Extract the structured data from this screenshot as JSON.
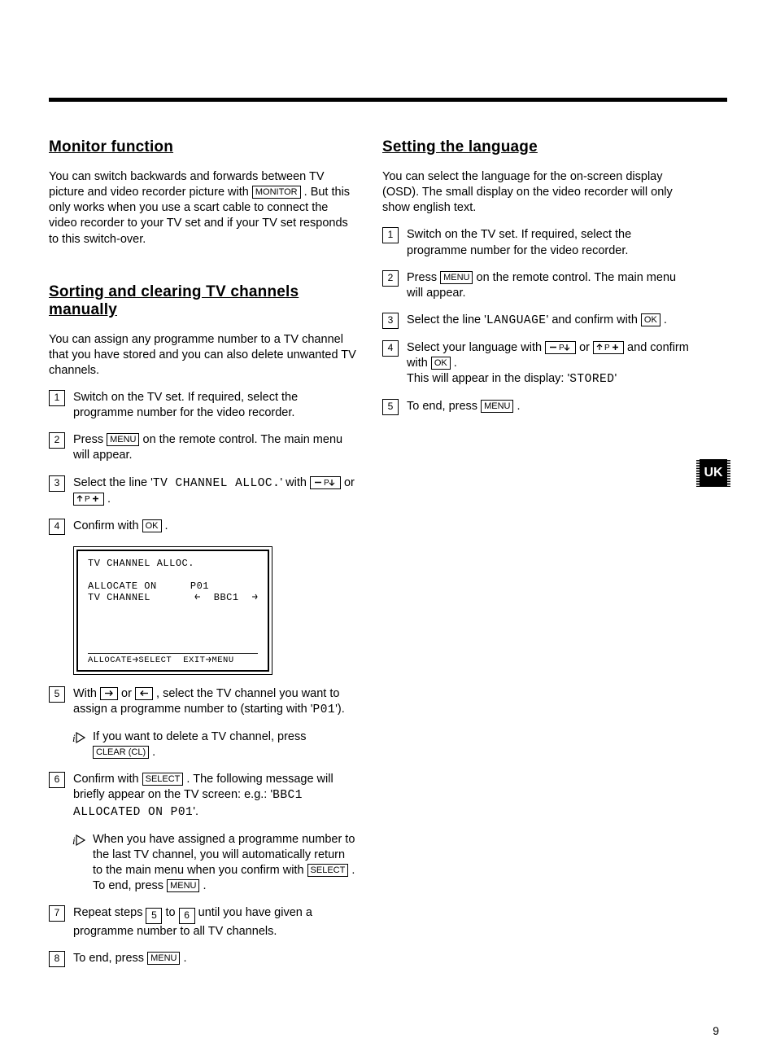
{
  "page_number": "9",
  "uk_tab": "UK",
  "buttons": {
    "monitor": "MONITOR",
    "menu": "MENU",
    "ok": "OK",
    "select": "SELECT",
    "clear": "CLEAR (CL)"
  },
  "col1": {
    "h1": "Monitor function",
    "p1a": "You can switch backwards and forwards between TV picture and video recorder picture with ",
    "p1b": " . But this only works when you use a scart cable to connect the video recorder to your TV set and if your TV set responds to this switch-over.",
    "h2": "Sorting and clearing TV channels manually",
    "p2": "You can assign any programme number to a TV channel that you have stored and you can also delete unwanted TV channels.",
    "s1": "Switch on the TV set. If required, select the programme number for the video recorder.",
    "s2a": "Press ",
    "s2b": " on the remote control. The main menu will appear.",
    "s3a": "Select the line '",
    "s3_line": "TV CHANNEL ALLOC.",
    "s3b": "' with ",
    "s3c": " or ",
    "s3d": " .",
    "s4a": "Confirm with ",
    "s4b": " .",
    "osd": {
      "title": "TV CHANNEL ALLOC.",
      "l1a": "ALLOCATE ON",
      "l1b": "P01",
      "l2a": "TV CHANNEL",
      "l2b": "BBC1",
      "f1": "ALLOCATE",
      "f2": "SELECT",
      "f3": "EXIT",
      "f4": "MENU"
    },
    "s5a": "With ",
    "s5b": " or ",
    "s5c": " , select the TV channel you want to assign a programme number to (starting with '",
    "s5_pn": "P01",
    "s5d": "').",
    "note1a": "If you want to delete a TV channel, press ",
    "note1b": " .",
    "s6a": "Confirm with ",
    "s6b": " . The following message will briefly appear on the TV screen: e.g.: '",
    "s6_msg": "BBC1 ALLOCATED ON P01",
    "s6c": "'.",
    "note2a": "When you have assigned a programme number to the last TV channel, you will automatically return to the main menu when you confirm with ",
    "note2b": " . To end, press ",
    "note2c": " .",
    "s7a": "Repeat steps ",
    "s7_n1": "5",
    "s7b": " to ",
    "s7_n2": "6",
    "s7c": " until  you have given a programme number to all TV channels.",
    "s8a": "To end, press ",
    "s8b": " ."
  },
  "col2": {
    "h1": "Setting the language",
    "p1": "You can select the language for the on-screen display (OSD). The small display on the video recorder will only show english text.",
    "s1": "Switch on the TV set. If required, select the programme number for the video recorder.",
    "s2a": "Press ",
    "s2b": " on the remote control. The main menu will appear.",
    "s3a": "Select the line '",
    "s3_line": "LANGUAGE",
    "s3b": "' and confirm with ",
    "s3c": " .",
    "s4a": "Select your language with ",
    "s4b": " or ",
    "s4c": " and confirm with ",
    "s4d": " .",
    "s4e": "This will appear in the display: '",
    "s4_msg": "STORED",
    "s4f": "'",
    "s5a": "To end, press ",
    "s5b": " ."
  }
}
